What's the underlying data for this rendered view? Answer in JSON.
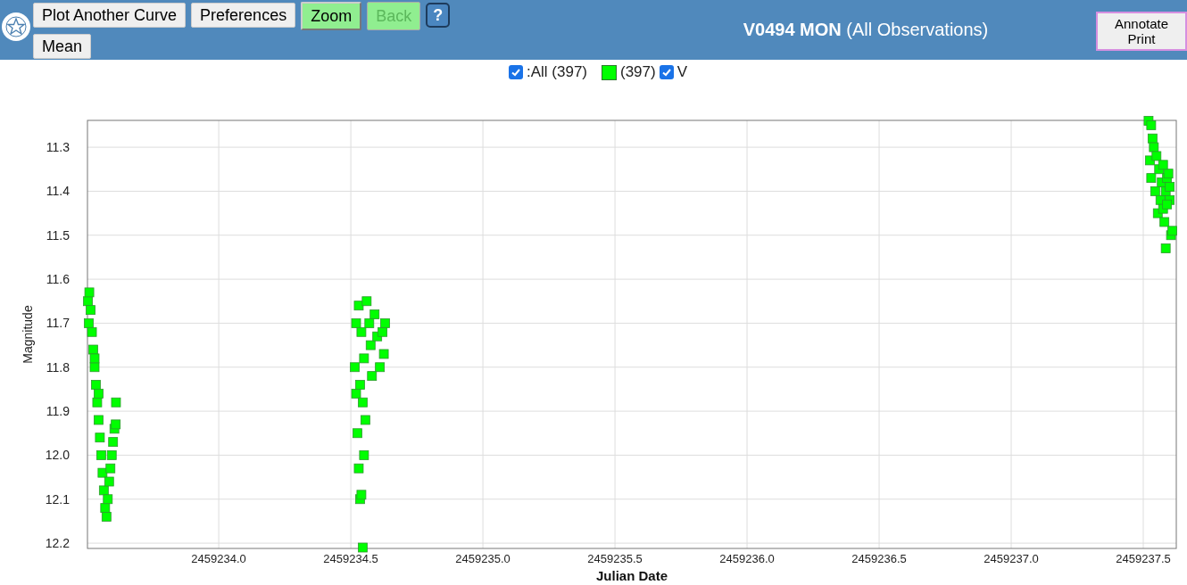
{
  "toolbar": {
    "buttons": [
      {
        "label": "Plot Another Curve",
        "kind": "plain",
        "disabled": false
      },
      {
        "label": "Preferences",
        "kind": "plain",
        "disabled": false
      },
      {
        "label": "Zoom",
        "kind": "toggle",
        "disabled": false
      },
      {
        "label": "Back",
        "kind": "toggle",
        "disabled": true
      },
      {
        "label": "?",
        "kind": "help",
        "disabled": false
      },
      {
        "label": "Mean",
        "kind": "plain",
        "disabled": false
      }
    ]
  },
  "title": "**V0494 MON** (All Observations)",
  "annotate_button": [
    "Annotate",
    "Print"
  ],
  "legend": [
    {
      "kind": "checkbox",
      "checked": true,
      "label": ":All (397)"
    },
    {
      "kind": "swatch",
      "label": "(397)"
    },
    {
      "kind": "series_checkbox",
      "checked": true
    }
  ],
  "chart_data": {
    "type": "scatter",
    "grid": true,
    "xlabel": "Julian Date",
    "ylabel": "Magnitude",
    "xlim": [
      2459233.503,
      2459237.625
    ],
    "ylim": [
      12.212,
      11.239
    ],
    "xticks": [
      {
        "value": 2459234.0,
        "label": "2459234.0"
      },
      {
        "value": 2459234.5,
        "label": "2459234.5"
      },
      {
        "value": 2459235.0,
        "label": "2459235.0"
      },
      {
        "value": 2459235.5,
        "label": "2459235.5"
      },
      {
        "value": 2459236.0,
        "label": "2459236.0"
      },
      {
        "value": 2459236.5,
        "label": "2459236.5"
      },
      {
        "value": 2459237.0,
        "label": "2459237.0"
      },
      {
        "value": 2459237.5,
        "label": "2459237.5"
      }
    ],
    "yticks": [
      {
        "value": 11.3,
        "label": "11.3"
      },
      {
        "value": 11.4,
        "label": "11.4"
      },
      {
        "value": 11.5,
        "label": "11.5"
      },
      {
        "value": 11.6,
        "label": "11.6"
      },
      {
        "value": 11.7,
        "label": "11.7"
      },
      {
        "value": 11.8,
        "label": "11.8"
      },
      {
        "value": 11.9,
        "label": "11.9"
      },
      {
        "value": 12.0,
        "label": "12.0"
      },
      {
        "value": 12.1,
        "label": "12.1"
      },
      {
        "value": 12.2,
        "label": "12.2"
      }
    ],
    "x": [
      2459233.505,
      2459233.508,
      2459233.51,
      2459233.515,
      2459233.52,
      2459233.525,
      2459233.53,
      2459233.535,
      2459233.54,
      2459233.545,
      2459233.55,
      2459233.555,
      2459233.56,
      2459233.565,
      2459233.57,
      2459233.575,
      2459233.58,
      2459233.585,
      2459233.59,
      2459233.595,
      2459233.6,
      2459233.605,
      2459233.61,
      2459233.611,
      2459233.545,
      2459233.53,
      2459234.515,
      2459234.52,
      2459234.525,
      2459234.53,
      2459234.535,
      2459234.54,
      2459234.545,
      2459234.55,
      2459234.555,
      2459234.52,
      2459234.53,
      2459234.54,
      2459234.55,
      2459234.56,
      2459234.57,
      2459234.575,
      2459234.58,
      2459234.59,
      2459234.6,
      2459234.61,
      2459234.62,
      2459234.625,
      2459234.63,
      2459234.535,
      2459234.545,
      2459237.52,
      2459237.53,
      2459237.535,
      2459237.54,
      2459237.525,
      2459237.53,
      2459237.55,
      2459237.56,
      2459237.545,
      2459237.555,
      2459237.565,
      2459237.57,
      2459237.575,
      2459237.58,
      2459237.585,
      2459237.59,
      2459237.595,
      2459237.6,
      2459237.605,
      2459237.585,
      2459237.61,
      2459237.575,
      2459237.59,
      2459237.6
    ],
    "series": [
      {
        "name": "V",
        "color": "#00ff00",
        "values": [
          11.65,
          11.7,
          11.63,
          11.67,
          11.72,
          11.76,
          11.8,
          11.84,
          11.88,
          11.92,
          11.96,
          12.0,
          12.04,
          12.08,
          12.12,
          12.14,
          12.1,
          12.06,
          12.03,
          12.0,
          11.97,
          11.94,
          11.93,
          11.88,
          11.86,
          11.78,
          11.8,
          11.86,
          11.95,
          12.03,
          12.1,
          12.09,
          12.21,
          12.0,
          11.92,
          11.7,
          11.66,
          11.72,
          11.78,
          11.65,
          11.7,
          11.75,
          11.82,
          11.68,
          11.73,
          11.8,
          11.72,
          11.77,
          11.7,
          11.84,
          11.88,
          11.24,
          11.25,
          11.28,
          11.3,
          11.33,
          11.37,
          11.32,
          11.35,
          11.4,
          11.45,
          11.42,
          11.38,
          11.44,
          11.47,
          11.4,
          11.37,
          11.36,
          11.42,
          11.5,
          11.53,
          11.49,
          11.34,
          11.43,
          11.39
        ]
      }
    ]
  }
}
